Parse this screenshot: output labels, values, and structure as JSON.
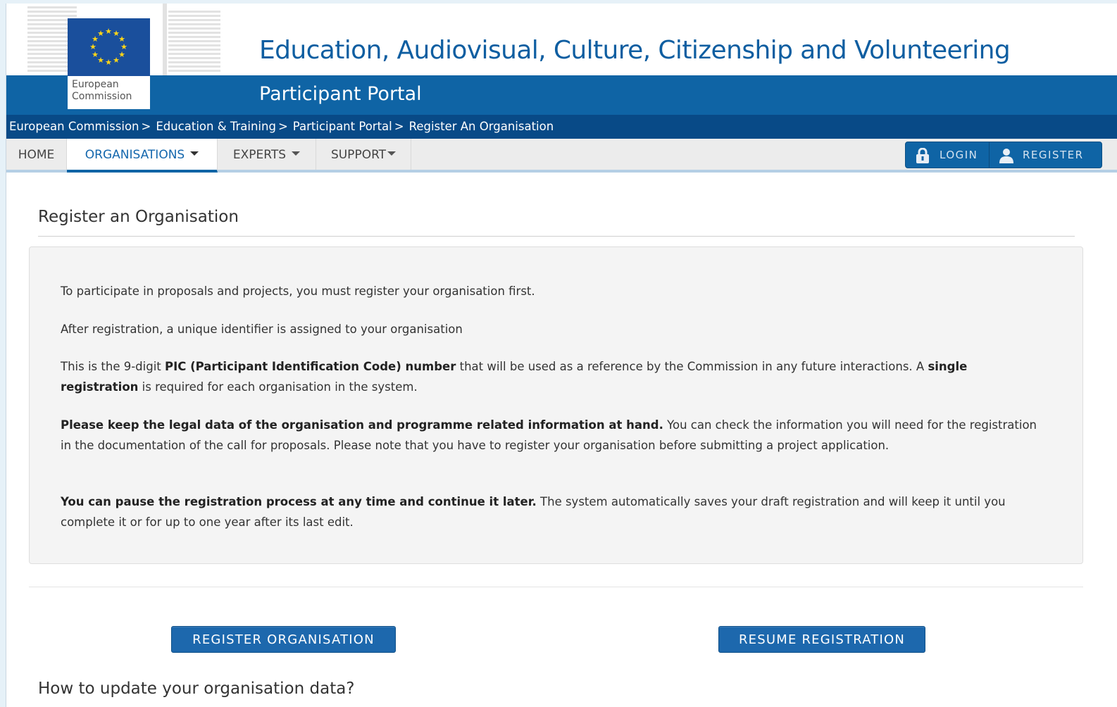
{
  "header": {
    "logo_line1": "European",
    "logo_line2": "Commission",
    "site_title": "Education, Audiovisual, Culture, Citizenship and Volunteering",
    "portal_title": "Participant Portal"
  },
  "breadcrumb": {
    "items": [
      "European Commission",
      "Education & Training",
      "Participant Portal",
      "Register An Organisation"
    ],
    "separator": ">"
  },
  "nav": {
    "items": [
      {
        "label": "HOME",
        "has_dropdown": false,
        "active": false
      },
      {
        "label": "ORGANISATIONS",
        "has_dropdown": true,
        "active": true
      },
      {
        "label": "EXPERTS",
        "has_dropdown": true,
        "active": false
      },
      {
        "label": "SUPPORT",
        "has_dropdown": true,
        "active": false
      }
    ],
    "login_label": "LOGIN",
    "register_label": "REGISTER"
  },
  "main": {
    "title": "Register an Organisation",
    "paragraphs": {
      "p1": "To participate in proposals and projects, you must register your organisation first.",
      "p2": "After registration, a unique identifier is assigned to your organisation",
      "p3_pre": "This is the 9-digit ",
      "p3_bold1": "PIC (Participant Identification Code) number",
      "p3_mid": " that will be used as a reference by the Commission in any future interactions. A ",
      "p3_bold2": "single registration",
      "p3_post": " is required for each organisation in the system.",
      "p4_bold": "Please keep the legal data of the organisation and programme related information at hand.",
      "p4_rest": " You can check the information you will need for the registration in the documentation of the call for proposals. Please note that you have to register your organisation before submitting a project application.",
      "p5_bold": "You can pause the registration process at any time and continue it later.",
      "p5_rest": " The system automatically saves your draft registration and will keep it until you complete it or for up to one year after its last edit."
    },
    "register_button": "REGISTER ORGANISATION",
    "resume_button": "RESUME REGISTRATION",
    "update_heading": "How to update your organisation data?"
  },
  "colors": {
    "brand_blue": "#0f64a5",
    "breadcrumb_blue": "#084a87",
    "title_blue": "#0e5ea1",
    "eu_flag_blue": "#1a4f9c",
    "eu_star_yellow": "#ffd617"
  },
  "icons": {
    "login": "padlock-icon",
    "register": "user-icon",
    "dropdown": "caret-down-icon"
  }
}
